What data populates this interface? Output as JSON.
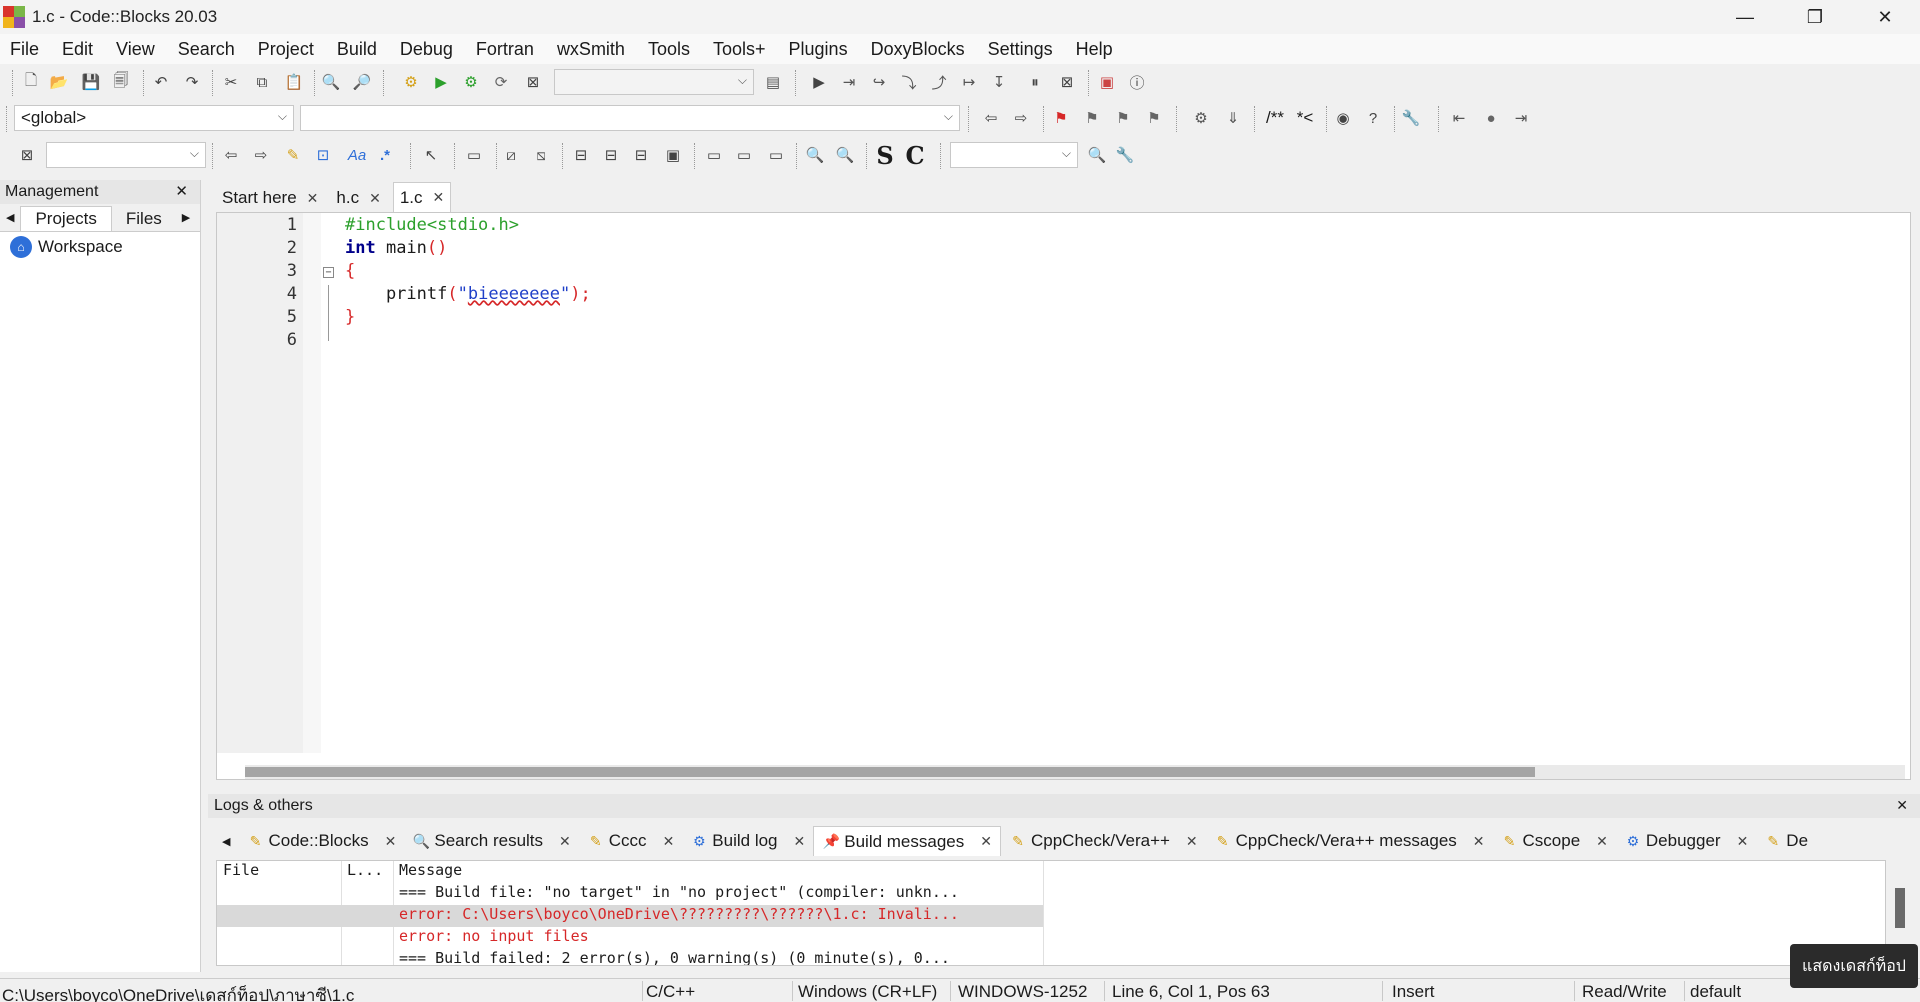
{
  "window": {
    "title": "1.c - Code::Blocks 20.03",
    "minimize": "—",
    "maximize": "❐",
    "close": "✕"
  },
  "menu": [
    "File",
    "Edit",
    "View",
    "Search",
    "Project",
    "Build",
    "Debug",
    "Fortran",
    "wxSmith",
    "Tools",
    "Tools+",
    "Plugins",
    "DoxyBlocks",
    "Settings",
    "Help"
  ],
  "toolbar2": {
    "scope": "<global>",
    "symbol": "",
    "comment_doxy": "/**",
    "comment_line": "*<"
  },
  "toolbar3": {
    "search_value": "",
    "bold_s": "S",
    "bold_c": "C",
    "regex": ".*",
    "case": "Aa"
  },
  "management": {
    "title": "Management",
    "tabs": [
      "Projects",
      "Files"
    ],
    "tree": {
      "workspace": "Workspace"
    }
  },
  "editor": {
    "tabs": [
      {
        "label": "Start here"
      },
      {
        "label": "h.c"
      },
      {
        "label": "1.c"
      }
    ],
    "lines": [
      {
        "n": "1",
        "include": "#include<stdio.h>"
      },
      {
        "n": "2",
        "kw": "int",
        "rest": " main",
        "paren": "()"
      },
      {
        "n": "3",
        "brace": "{"
      },
      {
        "n": "4",
        "fn": "    printf",
        "open": "(",
        "q1": "\"",
        "str": "bieeeeeee",
        "q2": "\"",
        "close": ");"
      },
      {
        "n": "5",
        "brace": "}"
      },
      {
        "n": "6"
      }
    ]
  },
  "logs": {
    "title": "Logs & others",
    "tabs": [
      "Code::Blocks",
      "Search results",
      "Cccc",
      "Build log",
      "Build messages",
      "CppCheck/Vera++",
      "CppCheck/Vera++ messages",
      "Cscope",
      "Debugger",
      "De"
    ],
    "columns": [
      "File",
      "L...",
      "Message"
    ],
    "rows": [
      {
        "file": "",
        "line": "",
        "msg": "=== Build file: \"no target\" in \"no project\" (compiler: unkn...",
        "type": "info"
      },
      {
        "file": "",
        "line": "",
        "msg": "error: C:\\Users\\boyco\\OneDrive\\?????????\\??????\\1.c: Invali...",
        "type": "error"
      },
      {
        "file": "",
        "line": "",
        "msg": "error: no input files",
        "type": "error"
      },
      {
        "file": "",
        "line": "",
        "msg": "=== Build failed: 2 error(s), 0 warning(s) (0 minute(s), 0...",
        "type": "info"
      }
    ]
  },
  "status": {
    "path": "C:\\Users\\boyco\\OneDrive\\เดสก์ท็อป\\ภาษาซี\\1.c",
    "lang": "C/C++",
    "eol": "Windows (CR+LF)",
    "encoding": "WINDOWS-1252",
    "position": "Line 6, Col 1, Pos 63",
    "mode": "Insert",
    "access": "Read/Write",
    "profile": "default"
  },
  "tooltip": "แสดงเดสก์ท็อป",
  "colors": {
    "preprocessor": "#2ca02c",
    "keyword": "#00008b",
    "string": "#1f3fc8",
    "error": "#d62728"
  }
}
